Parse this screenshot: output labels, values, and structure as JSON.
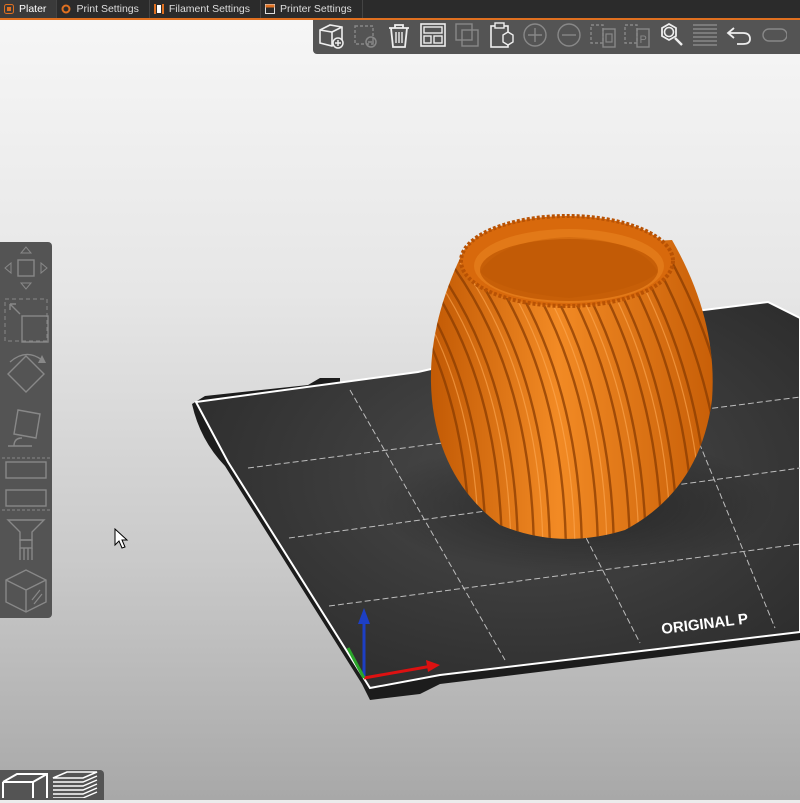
{
  "tabs": [
    {
      "label": "Plater",
      "icon": "plater-icon",
      "active": true
    },
    {
      "label": "Print Settings",
      "icon": "print-settings-icon",
      "active": false
    },
    {
      "label": "Filament Settings",
      "icon": "filament-icon",
      "active": false
    },
    {
      "label": "Printer Settings",
      "icon": "printer-icon",
      "active": false
    }
  ],
  "top_toolbar": [
    "add-icon",
    "delete-icon",
    "delete-all-icon",
    "arrange-icon",
    "copy-icon",
    "paste-icon",
    "add-instance-icon",
    "remove-instance-icon",
    "split-objects-icon",
    "split-parts-icon",
    "search-icon",
    "layers-editing-icon",
    "undo-icon",
    "redo-icon"
  ],
  "left_toolbar": [
    "move-icon",
    "scale-icon",
    "rotate-icon",
    "place-on-face-icon",
    "cut-icon",
    "paint-supports-icon",
    "seam-painting-icon",
    "fdm-supports-icon",
    "variable-layer-icon"
  ],
  "bottom_toolbar": [
    "3d-view-icon",
    "preview-layers-icon"
  ],
  "bed_label": "ORIGINAL P",
  "colors": {
    "accent": "#e07020",
    "toolbar": "#545454",
    "bed": "#333333",
    "model": "#e5730f"
  }
}
